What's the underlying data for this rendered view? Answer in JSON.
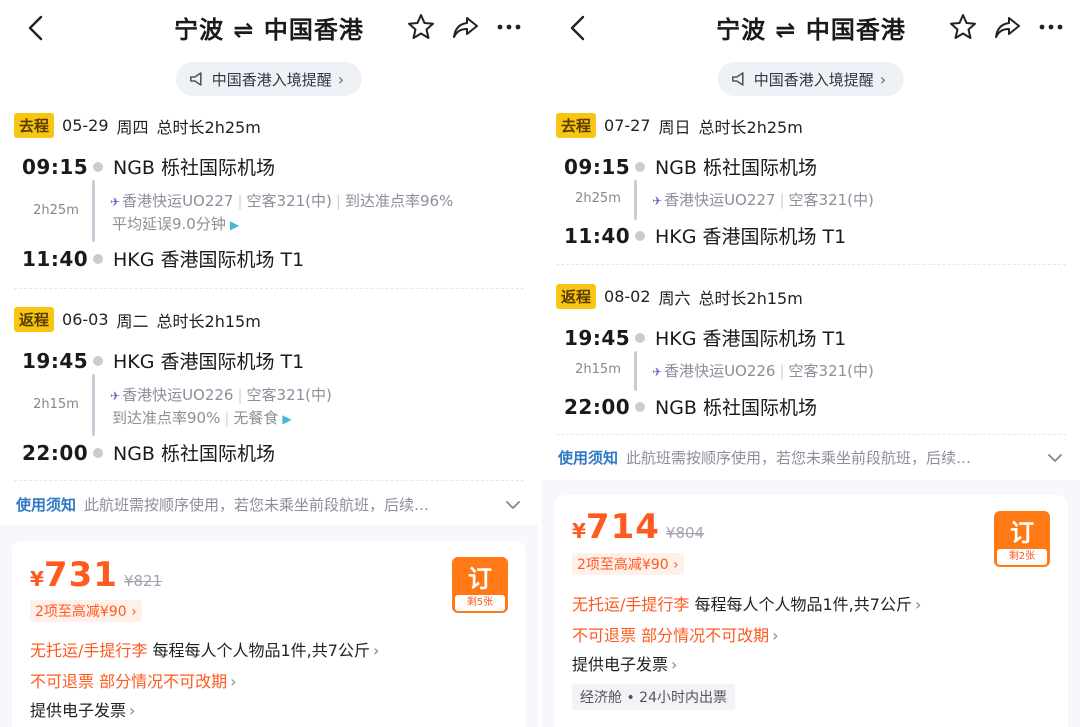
{
  "accent_color": "#ff5a1f",
  "tag_color": "#f7c614",
  "link_color": "#2f78c4",
  "panels": [
    {
      "title": "宁波 ⇌ 中国香港",
      "notice": "中国香港入境提醒",
      "outbound": {
        "tag": "去程",
        "date": "05-29",
        "weekday": "周四",
        "duration_total": "总时长2h25m",
        "dep_time": "09:15",
        "dep_airport": "NGB 栎社国际机场",
        "leg_duration": "2h25m",
        "airline": "香港快运UO227",
        "aircraft": "空客321(中)",
        "ontime": "到达准点率96%",
        "delay": "平均延误9.0分钟",
        "arr_time": "11:40",
        "arr_airport": "HKG 香港国际机场 T1"
      },
      "return": {
        "tag": "返程",
        "date": "06-03",
        "weekday": "周二",
        "duration_total": "总时长2h15m",
        "dep_time": "19:45",
        "dep_airport": "HKG 香港国际机场 T1",
        "leg_duration": "2h15m",
        "airline": "香港快运UO226",
        "aircraft": "空客321(中)",
        "ontime": "到达准点率90%",
        "meal": "无餐食",
        "arr_time": "22:00",
        "arr_airport": "NGB 栎社国际机场"
      },
      "rules_label": "使用须知",
      "rules_text": "此航班需按顺序使用，若您未乘坐前段航班，后续…",
      "price_currency": "¥",
      "price": "731",
      "orig_price": "¥821",
      "discount": "2项至高减¥90",
      "book_label": "订",
      "remaining": "剩5张",
      "baggage_label": "无托运/手提行李",
      "baggage_text": "每程每人个人物品1件,共7公斤",
      "refund_text": "不可退票 部分情况不可改期",
      "invoice_text": "提供电子发票"
    },
    {
      "title": "宁波 ⇌ 中国香港",
      "notice": "中国香港入境提醒",
      "outbound": {
        "tag": "去程",
        "date": "07-27",
        "weekday": "周日",
        "duration_total": "总时长2h25m",
        "dep_time": "09:15",
        "dep_airport": "NGB 栎社国际机场",
        "leg_duration": "2h25m",
        "airline": "香港快运UO227",
        "aircraft": "空客321(中)",
        "arr_time": "11:40",
        "arr_airport": "HKG 香港国际机场 T1"
      },
      "return": {
        "tag": "返程",
        "date": "08-02",
        "weekday": "周六",
        "duration_total": "总时长2h15m",
        "dep_time": "19:45",
        "dep_airport": "HKG 香港国际机场 T1",
        "leg_duration": "2h15m",
        "airline": "香港快运UO226",
        "aircraft": "空客321(中)",
        "arr_time": "22:00",
        "arr_airport": "NGB 栎社国际机场"
      },
      "rules_label": "使用须知",
      "rules_text": "此航班需按顺序使用，若您未乘坐前段航班，后续…",
      "price_currency": "¥",
      "price": "714",
      "orig_price": "¥804",
      "discount": "2项至高减¥90",
      "book_label": "订",
      "remaining": "剩2张",
      "baggage_label": "无托运/手提行李",
      "baggage_text": "每程每人个人物品1件,共7公斤",
      "refund_text": "不可退票 部分情况不可改期",
      "invoice_text": "提供电子发票",
      "cabin_text": "经济舱 • 24小时内出票"
    }
  ]
}
